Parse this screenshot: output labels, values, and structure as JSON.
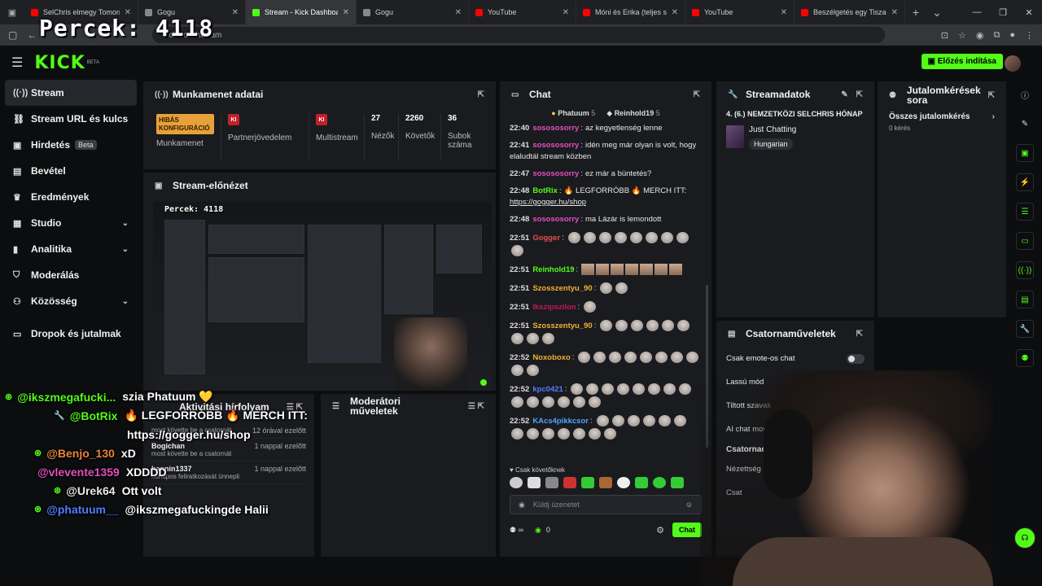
{
  "overlay": {
    "counter": "Percek: 4118"
  },
  "browser": {
    "tabs": [
      {
        "label": "SelChris elmegy Tomorrowl",
        "color": "#ff0000",
        "active": false
      },
      {
        "label": "Gogu",
        "color": "#888888",
        "active": false
      },
      {
        "label": "Stream - Kick Dashboard",
        "color": "#53fc18",
        "active": true
      },
      {
        "label": "Gogu",
        "color": "#888888",
        "active": false
      },
      {
        "label": "YouTube",
        "color": "#ff0000",
        "active": false
      },
      {
        "label": "Móni és Erika (teljes soroza",
        "color": "#ff0000",
        "active": false
      },
      {
        "label": "YouTube",
        "color": "#ff0000",
        "active": false
      },
      {
        "label": "Beszélgetés egy Tisza szim",
        "color": "#ff0000",
        "active": false
      }
    ],
    "url": "ck.com/stream"
  },
  "header": {
    "logo": "KICK",
    "beta": "BETA",
    "preview_button": "Előzés indítása"
  },
  "sidebar": {
    "items": [
      {
        "label": "Stream",
        "icon": "((·))",
        "name": "stream"
      },
      {
        "label": "Stream URL és kulcs",
        "icon": "⛓",
        "name": "stream-url"
      },
      {
        "label": "Hirdetés",
        "icon": "▣",
        "name": "ads",
        "badge": "Beta"
      },
      {
        "label": "Bevétel",
        "icon": "▤",
        "name": "revenue"
      },
      {
        "label": "Eredmények",
        "icon": "♛",
        "name": "results"
      },
      {
        "label": "Studio",
        "icon": "▦",
        "name": "studio",
        "chevron": "⌄"
      },
      {
        "label": "Analitika",
        "icon": "▮",
        "name": "analytics",
        "chevron": "⌄"
      },
      {
        "label": "Moderálás",
        "icon": "⛉",
        "name": "moderation"
      },
      {
        "label": "Közösség",
        "icon": "⚇",
        "name": "community",
        "chevron": "⌄"
      },
      {
        "label": "Dropok és jutalmak",
        "icon": "▭",
        "name": "drops"
      }
    ]
  },
  "session": {
    "title": "Munkamenet adatai",
    "stats": [
      {
        "value": "HIBÁS KONFIGURÁCIÓ",
        "label": "Munkamenet",
        "type": "error"
      },
      {
        "value": "KI",
        "label": "Partnerjövedelem",
        "type": "ki"
      },
      {
        "value": "KI",
        "label": "Multistream",
        "type": "ki"
      },
      {
        "value": "27",
        "label": "Nézők",
        "type": "num"
      },
      {
        "value": "2260",
        "label": "Követők",
        "type": "num"
      },
      {
        "value": "36",
        "label": "Subok száma",
        "type": "num"
      }
    ]
  },
  "preview": {
    "title": "Stream-előnézet",
    "counter": "Percek: 4118"
  },
  "activity": {
    "title": "Aktivitási hírfolyam",
    "rows": [
      {
        "name": "",
        "sub": "most követte be a csatornát",
        "time": "12 órával ezelőtt"
      },
      {
        "name": "Bogichan",
        "sub": "most követte be a csatornát",
        "time": "1 nappal ezelőtt"
      },
      {
        "name": "hannin1337",
        "sub": "hónapos feliratkozását ünnepli",
        "time": "1 nappal ezelőtt"
      }
    ]
  },
  "mod_actions": {
    "title": "Moderátori műveletek"
  },
  "chat": {
    "title": "Chat",
    "pinned": [
      {
        "name": "Phatuum",
        "count": "5"
      },
      {
        "name": "Reinhold19",
        "count": "5"
      }
    ],
    "messages": [
      {
        "time": "22:40",
        "user": "sosososorry",
        "color": "#e34fbf",
        "text": "az kegyetlenség lenne"
      },
      {
        "time": "22:41",
        "user": "sosososorry",
        "color": "#e34fbf",
        "text": "idén meg már olyan is volt, hogy elaludtál stream közben"
      },
      {
        "time": "22:47",
        "user": "sosososorry",
        "color": "#e34fbf",
        "text": "ez már a büntetés?"
      },
      {
        "time": "22:48",
        "user": "BotRix",
        "color": "#53fc18",
        "text": "🔥 LEGFORRÓBB 🔥 MERCH ITT:",
        "link": "https://gogger.hu/shop"
      },
      {
        "time": "22:48",
        "user": "sosososorry",
        "color": "#e34fbf",
        "text": "ma Lázár is lemondott"
      },
      {
        "time": "22:51",
        "user": "Gogger",
        "color": "#e34f4f",
        "text": "",
        "emotes": 9
      },
      {
        "time": "22:51",
        "user": "Reinhold19",
        "color": "#53fc18",
        "text": "",
        "emotes": 7
      },
      {
        "time": "22:51",
        "user": "Szosszentyu_90",
        "color": "#f2b134",
        "text": "",
        "emotes": 2
      },
      {
        "time": "22:51",
        "user": "Ikszipszilon",
        "color": "#c2185b",
        "text": "",
        "emotes": 1
      },
      {
        "time": "22:51",
        "user": "Szosszentyu_90",
        "color": "#f2b134",
        "text": "",
        "emotes": 9
      },
      {
        "time": "22:52",
        "user": "Noxoboxo",
        "color": "#f2b134",
        "text": "",
        "emotes": 10
      },
      {
        "time": "22:52",
        "user": "kpc0421",
        "color": "#4f7cff",
        "text": "",
        "emotes": 14
      },
      {
        "time": "22:52",
        "user": "KAcs4pikkcsor",
        "color": "#4fa3ff",
        "text": "",
        "emotes": 13
      }
    ],
    "follower_only": "Csak követőknek",
    "input_placeholder": "Küldj üzenetet",
    "infinity": "∞",
    "count": "0",
    "send": "Chat"
  },
  "stream_data": {
    "title": "Streamadatok",
    "stream_title": "4. (6.) NEMZETKÖZI SELCHRIS HÓNAP",
    "category": "Just Chatting",
    "tag": "Hungarian"
  },
  "rewards": {
    "title": "Jutalomkérések sora",
    "all": "Összes jutalomkérés",
    "count": "0 kérés"
  },
  "channel_ops": {
    "title": "Csatornaműveletek",
    "rows": [
      "Csak emote-os chat",
      "Lassú mód",
      "Tiltott szavak",
      "AI chat moderá"
    ],
    "section": "Csatornaop",
    "rows2": [
      "Nézettség mu",
      "Csat"
    ]
  },
  "stream_overlay_chat": [
    {
      "user": "@ikszmegafucki...",
      "text": "szia Phatuum 💛",
      "color": "#53fc18",
      "icon": "⊛"
    },
    {
      "user": "@BotRix",
      "text": "🔥 LEGFORRÓBB 🔥 MERCH ITT:",
      "color": "#53fc18",
      "icon": "🔧"
    },
    {
      "user": "",
      "text": "https://gogger.hu/shop",
      "color": "#ffffff",
      "icon": ""
    },
    {
      "user": "@Benjo_130",
      "text": "xD",
      "color": "#e8833a",
      "icon": "⊛"
    },
    {
      "user": "@vlevente1359",
      "text": "XDDDD",
      "color": "#e34fbf",
      "icon": ""
    },
    {
      "user": "@Urek64",
      "text": "Ott volt",
      "color": "#e8e8e8",
      "icon": "⊛"
    },
    {
      "user": "@phatuum__",
      "text": "@ikszmegafuckingde Halii",
      "color": "#4f7cff",
      "icon": "⊛"
    }
  ]
}
